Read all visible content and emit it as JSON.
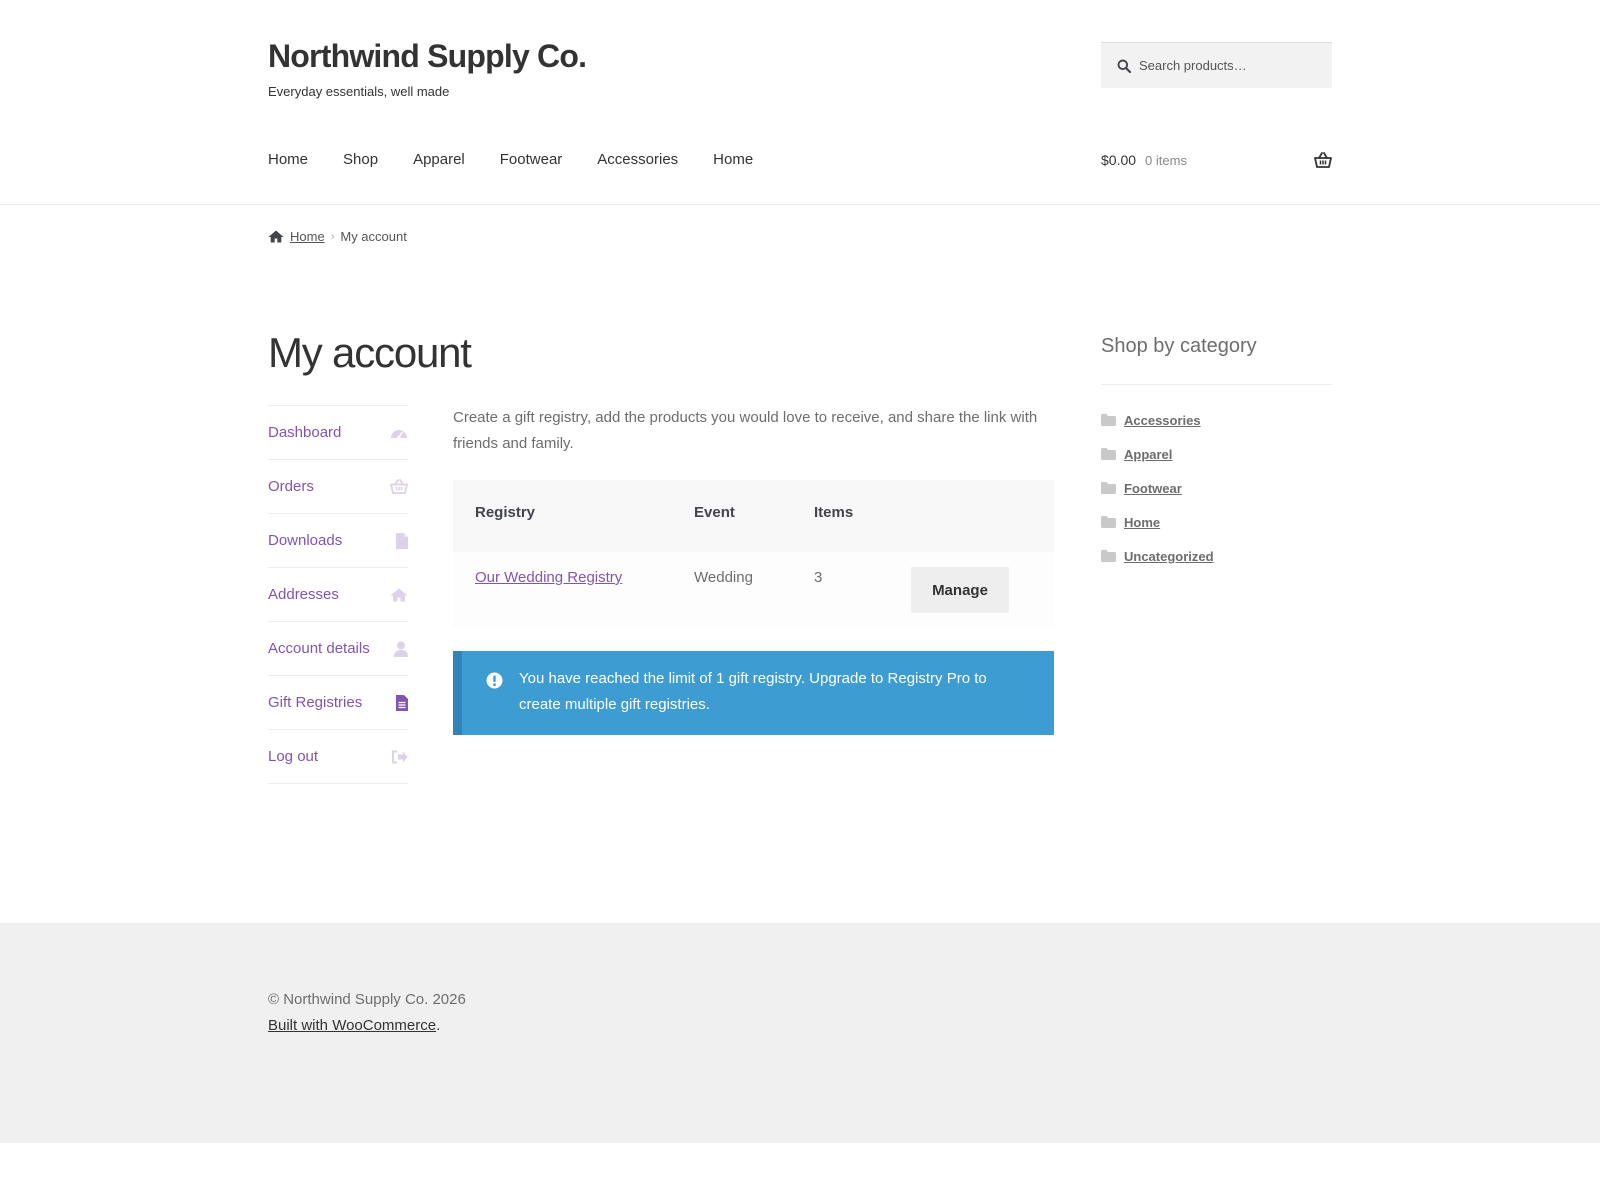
{
  "site": {
    "title": "Northwind Supply Co.",
    "tagline": "Everyday essentials, well made"
  },
  "search": {
    "placeholder": "Search products…"
  },
  "nav": [
    "Home",
    "Shop",
    "Apparel",
    "Footwear",
    "Accessories",
    "Home"
  ],
  "cart": {
    "amount": "$0.00",
    "count": "0 items"
  },
  "breadcrumb": {
    "home": "Home",
    "current": "My account"
  },
  "page": {
    "title": "My account"
  },
  "account_nav": [
    {
      "label": "Dashboard",
      "icon": "dashboard-icon"
    },
    {
      "label": "Orders",
      "icon": "basket-icon"
    },
    {
      "label": "Downloads",
      "icon": "file-icon"
    },
    {
      "label": "Addresses",
      "icon": "home-icon"
    },
    {
      "label": "Account details",
      "icon": "user-icon"
    },
    {
      "label": "Gift Registries",
      "icon": "file-text-icon",
      "active": true
    },
    {
      "label": "Log out",
      "icon": "sign-out-icon"
    }
  ],
  "content": {
    "intro": "Create a gift registry, add the products you would love to receive, and share the link with friends and family.",
    "table": {
      "headers": [
        "Registry",
        "Event",
        "Items"
      ],
      "rows": [
        {
          "registry": "Our Wedding Registry",
          "event": "Wedding",
          "items": "3",
          "action": "Manage"
        }
      ]
    },
    "notice": "You have reached the limit of 1 gift registry. Upgrade to Registry Pro to create multiple gift registries."
  },
  "sidebar": {
    "title": "Shop by category",
    "categories": [
      "Accessories",
      "Apparel",
      "Footwear",
      "Home",
      "Uncategorized"
    ]
  },
  "footer": {
    "copyright": "© Northwind Supply Co. 2026",
    "built_link": "Built with WooCommerce",
    "built_suffix": "."
  },
  "colors": {
    "accent": "#7f54b3",
    "notice_bg": "#3d9cd2",
    "text": "#43454b"
  }
}
